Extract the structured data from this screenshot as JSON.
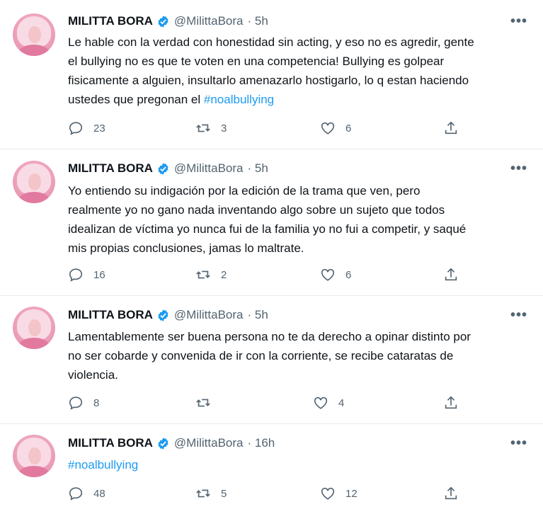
{
  "tweets": [
    {
      "name": "MILITTA BORA",
      "handle": "@MilittaBora",
      "time": "· 5h",
      "lines": [
        "Le hable con la verdad con honestidad sin acting, y eso no es agredir, gente",
        "el bullying no es que te voten en una competencia! Bullying es golpear",
        "fisicamente a alguien, insultarlo amenazarlo hostigarlo, lo q estan haciendo",
        "ustedes que pregonan el"
      ],
      "hashtag": "#noalbullying",
      "replies": "23",
      "retweets": "3",
      "likes": "6"
    },
    {
      "name": "MILITTA BORA",
      "handle": "@MilittaBora",
      "time": "· 5h",
      "lines": [
        "Yo entiendo su indigación por la edición de la trama que ven, pero",
        "realmente yo no gano nada inventando algo sobre un sujeto que todos",
        "idealizan de víctima yo nunca fui de la familia yo no fui a competir, y saqué",
        "mis propias conclusiones, jamas lo maltrate."
      ],
      "replies": "16",
      "retweets": "2",
      "likes": "6"
    },
    {
      "name": "MILITTA BORA",
      "handle": "@MilittaBora",
      "time": "· 5h",
      "lines": [
        "Lamentablemente ser buena persona no te da derecho a opinar distinto por",
        "no ser cobarde y convenida de ir con la corriente, se recibe cataratas de",
        "violencia."
      ],
      "replies": "8",
      "retweets": "",
      "likes": "4"
    },
    {
      "name": "MILITTA BORA",
      "handle": "@MilittaBora",
      "time": "· 16h",
      "hashtag": "#noalbullying",
      "replies": "48",
      "retweets": "5",
      "likes": "12"
    }
  ],
  "icons": {
    "more": "more-icon",
    "reply": "reply-icon",
    "retweet": "retweet-icon",
    "like": "heart-icon",
    "share": "share-icon",
    "verified": "verified-badge-icon"
  },
  "colors": {
    "accent": "#1d9bf0",
    "secondary": "#536471"
  }
}
